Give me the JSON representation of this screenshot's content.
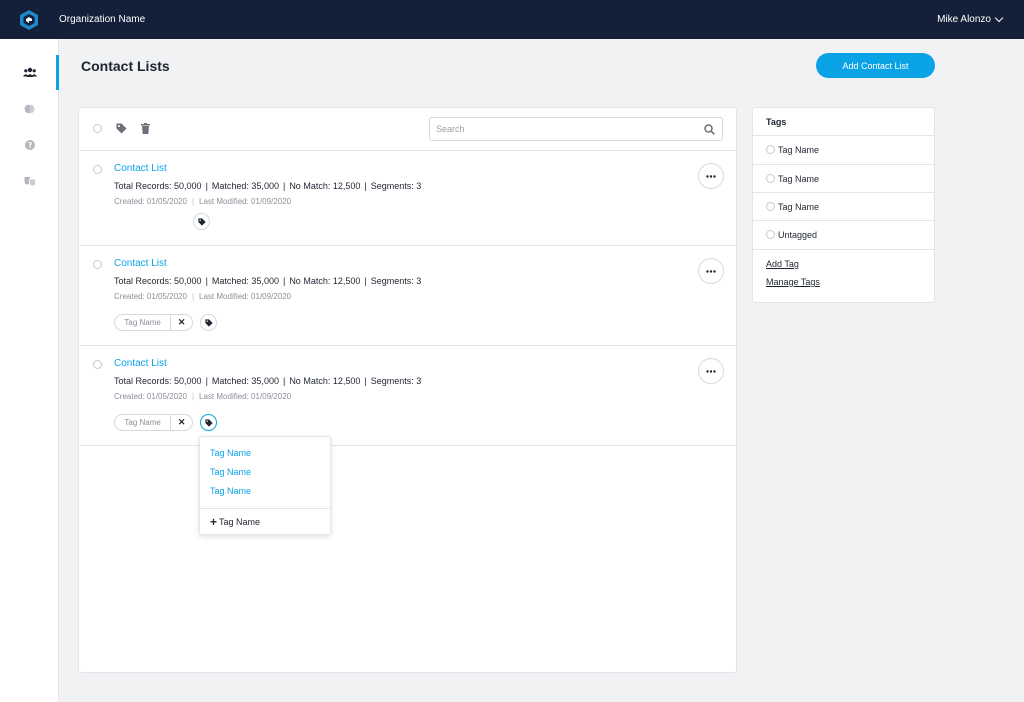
{
  "header": {
    "org_name": "Organization Name",
    "user_name": "Mike Alonzo"
  },
  "sidebar": {
    "items": [
      {
        "icon": "users-icon",
        "active": true
      },
      {
        "icon": "brain-icon",
        "active": false
      },
      {
        "icon": "help-icon",
        "active": false
      },
      {
        "icon": "masks-icon",
        "active": false
      }
    ]
  },
  "page": {
    "title": "Contact Lists",
    "add_button_label": "Add Contact List"
  },
  "toolbar": {
    "search_placeholder": "Search"
  },
  "contact_lists": [
    {
      "name": "Contact List",
      "total_records": "Total Records: 50,000",
      "matched": "Matched: 35,000",
      "no_match": "No Match: 12,500",
      "segments": "Segments: 3",
      "created": "Created: 01/05/2020",
      "modified": "Last Modified: 01/09/2020",
      "tags": []
    },
    {
      "name": "Contact List",
      "total_records": "Total Records: 50,000",
      "matched": "Matched: 35,000",
      "no_match": "No Match: 12,500",
      "segments": "Segments: 3",
      "created": "Created: 01/05/2020",
      "modified": "Last Modified: 01/09/2020",
      "tags": [
        "Tag Name"
      ]
    },
    {
      "name": "Contact List",
      "total_records": "Total Records: 50,000",
      "matched": "Matched: 35,000",
      "no_match": "No Match: 12,500",
      "segments": "Segments: 3",
      "created": "Created: 01/05/2020",
      "modified": "Last Modified: 01/09/2020",
      "tags": [
        "Tag Name"
      ]
    }
  ],
  "tag_dropdown": {
    "options": [
      "Tag Name",
      "Tag Name",
      "Tag Name"
    ],
    "add_label": "Tag Name"
  },
  "tags_panel": {
    "title": "Tags",
    "items": [
      "Tag Name",
      "Tag Name",
      "Tag Name",
      "Untagged"
    ],
    "add_tag": "Add Tag",
    "manage_tags": "Manage Tags"
  },
  "colors": {
    "accent": "#0aa3e6",
    "topbar": "#14203a"
  }
}
